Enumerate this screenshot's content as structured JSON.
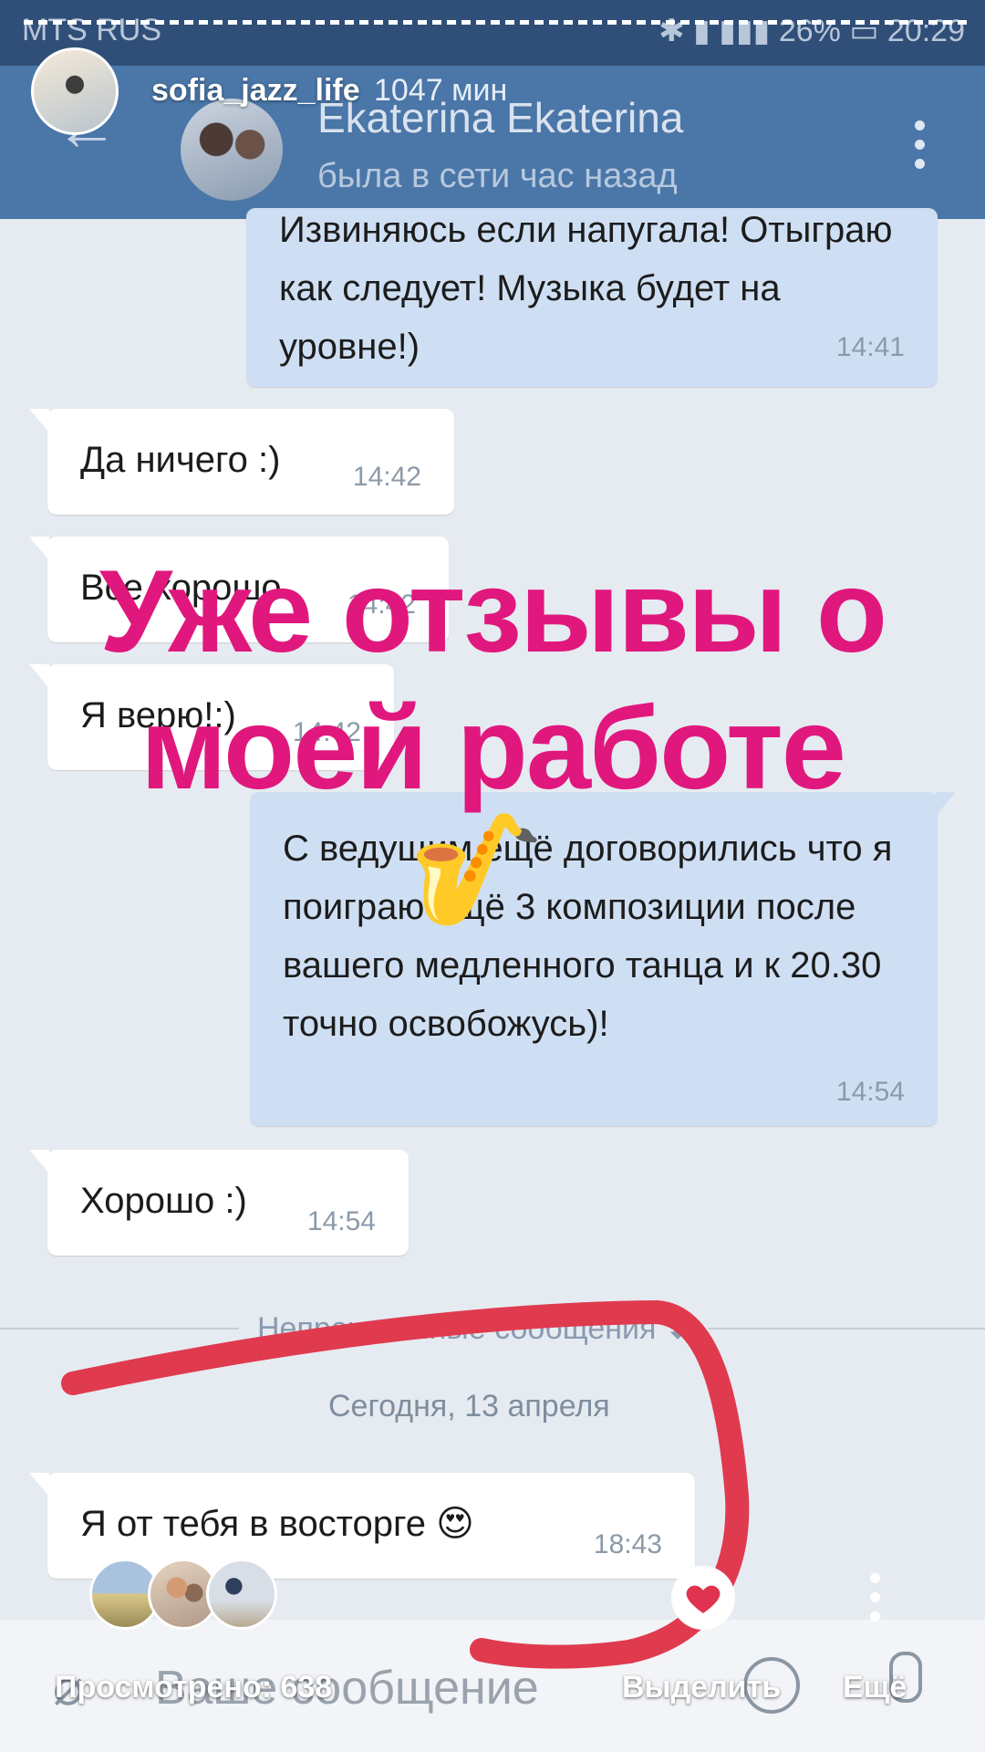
{
  "status_bar": {
    "carrier": "MTS RUS",
    "battery": "26%",
    "time": "20:29"
  },
  "story": {
    "username": "sofia_jazz_life",
    "posted_ago": "1047 мин",
    "overlay_text": "Уже отзывы о моей работе",
    "emoji": "🎷",
    "viewed_label": "Просмотрено: 638",
    "select_label": "Выделить",
    "more_label": "Ещё",
    "accent_color": "#e0187e",
    "annotation_color": "#e03a4f"
  },
  "chat": {
    "contact_name": "Ekaterina Ekaterina",
    "contact_status": "была в сети час назад",
    "messages": [
      {
        "dir": "out",
        "text": "Извиняюсь если напугала! Отыграю как следует! Музыка будет на уровне!)",
        "time": "14:41"
      },
      {
        "dir": "in",
        "text": "Да ничего :)",
        "time": "14:42"
      },
      {
        "dir": "in",
        "text": "Все хорошо",
        "time": "14:42"
      },
      {
        "dir": "in",
        "text": "Я верю!:)",
        "time": "14:42"
      },
      {
        "dir": "out",
        "text": "С ведущим ещё договорились что я поиграю ещё 3 композиции после вашего медленного танца и к 20.30 точно освобожусь)!",
        "time": "14:54"
      },
      {
        "dir": "in",
        "text": "Хорошо :)",
        "time": "14:54"
      },
      {
        "dir": "in",
        "text": "Я от тебя в восторге 😍",
        "time": "18:43"
      }
    ],
    "unread_divider": "Непрочитанные сообщения",
    "date_divider": "Сегодня, 13 апреля",
    "input_placeholder": "Ваше сообщение"
  },
  "icons": {
    "back": "arrow-left-icon",
    "menu": "more-vertical-icon",
    "attach": "paperclip-icon",
    "emoji": "smile-icon",
    "mic": "microphone-icon",
    "heart": "heart-icon",
    "down": "arrow-down-icon"
  }
}
